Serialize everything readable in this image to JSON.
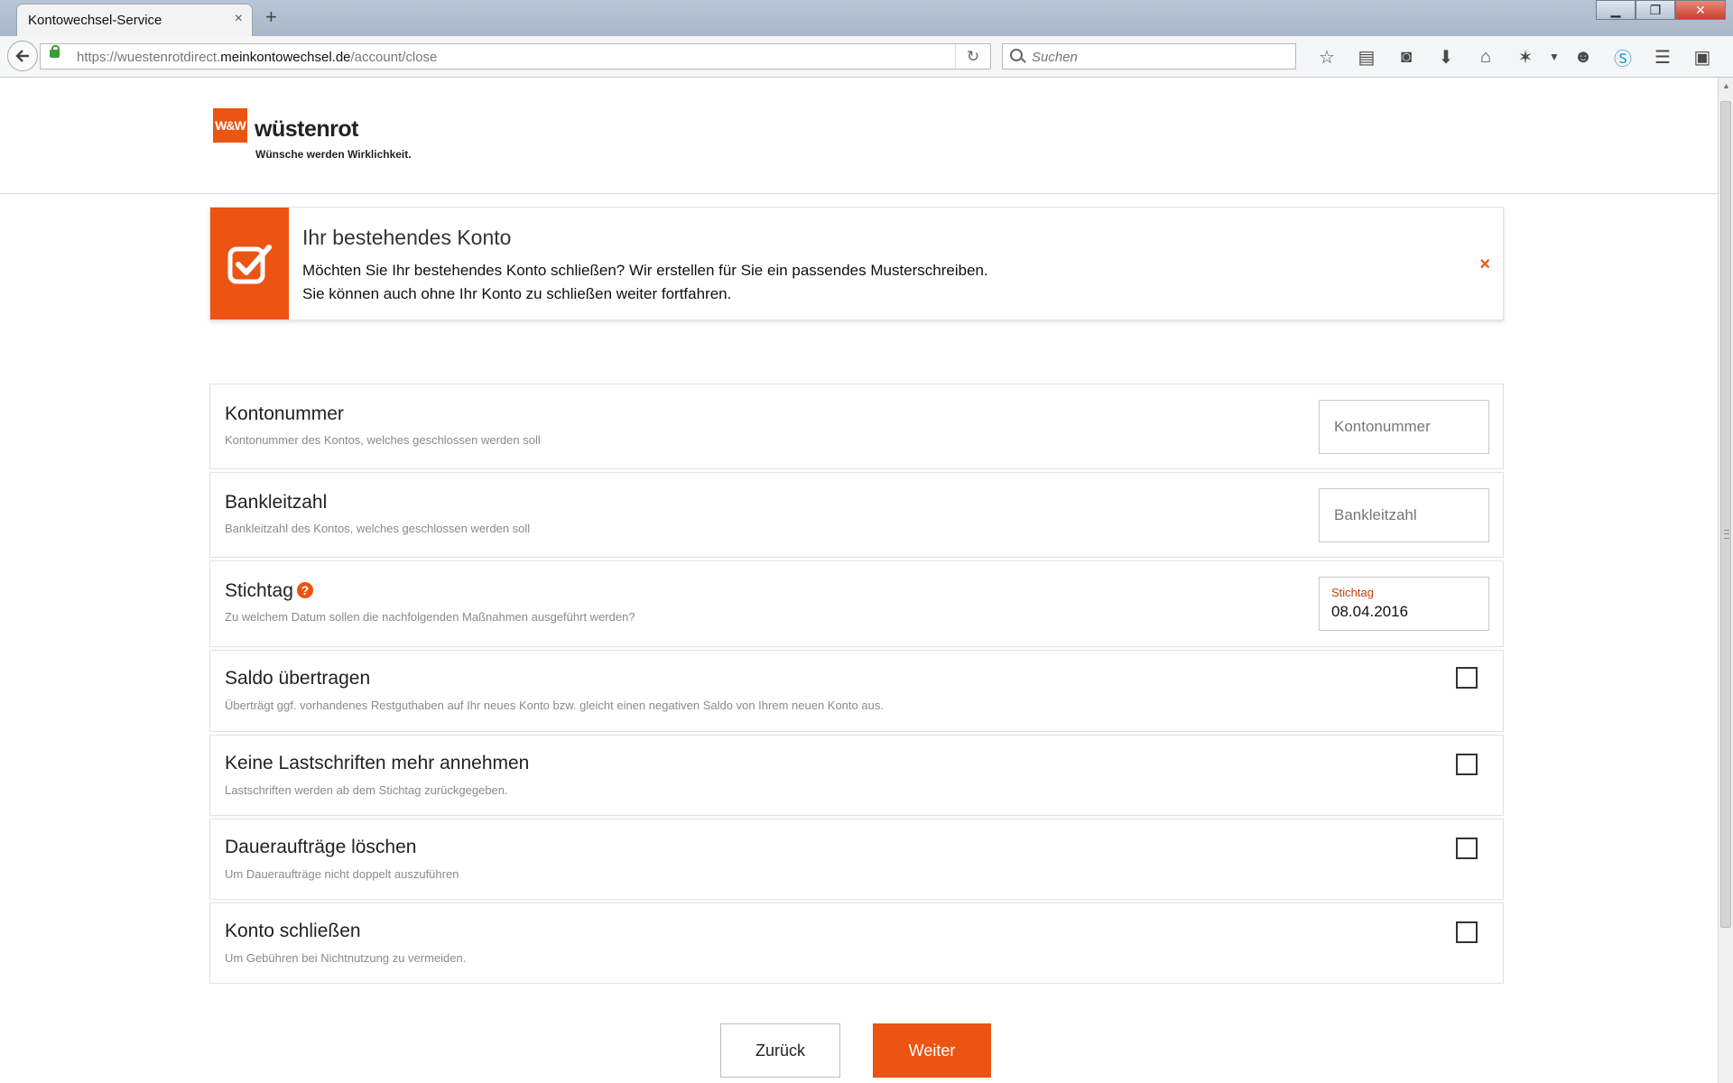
{
  "browser": {
    "tab_title": "Kontowechsel-Service",
    "tab_close": "×",
    "new_tab": "+",
    "url_prefix": "https://wuestenrotdirect.",
    "url_domain": "meinkontowechsel.de",
    "url_path": "/account/close",
    "search_placeholder": "Suchen",
    "window_controls": {
      "minimize": "▁",
      "maximize": "❐",
      "close": "✕"
    },
    "toolbar_icons": [
      "star-icon",
      "reading-list-icon",
      "pocket-icon",
      "download-icon",
      "home-icon",
      "extension-icon",
      "chevron-down-icon",
      "emoji-icon",
      "skype-icon",
      "menu-icon",
      "account-icon"
    ]
  },
  "brand": {
    "logo_mark": "W&W",
    "name": "wüstenrot",
    "claim": "Wünsche werden Wirklichkeit.",
    "accent_color": "#ec5413"
  },
  "notice": {
    "title": "Ihr bestehendes Konto",
    "line1": "Möchten Sie Ihr bestehendes Konto schließen? Wir erstellen für Sie ein passendes Musterschreiben.",
    "line2": "Sie können auch ohne Ihr Konto zu schließen weiter fortfahren.",
    "close": "×",
    "icon": "checkbox-checked-icon"
  },
  "form": {
    "kontonummer": {
      "title": "Kontonummer",
      "desc": "Kontonummer des Kontos, welches geschlossen werden soll",
      "placeholder": "Kontonummer",
      "value": ""
    },
    "bankleitzahl": {
      "title": "Bankleitzahl",
      "desc": "Bankleitzahl des Kontos, welches geschlossen werden soll",
      "placeholder": "Bankleitzahl",
      "value": ""
    },
    "stichtag": {
      "title": "Stichtag",
      "help": "?",
      "desc": "Zu welchem Datum sollen die nachfolgenden Maßnahmen ausgeführt werden?",
      "label": "Stichtag",
      "value": "08.04.2016"
    },
    "saldo": {
      "title": "Saldo übertragen",
      "desc": "Überträgt ggf. vorhandenes Restguthaben auf Ihr neues Konto bzw. gleicht einen negativen Saldo von Ihrem neuen Konto aus.",
      "checked": false
    },
    "lastschriften": {
      "title": "Keine Lastschriften mehr annehmen",
      "desc": "Lastschriften werden ab dem Stichtag zurückgegeben.",
      "checked": false
    },
    "dauerauftraege": {
      "title": "Daueraufträge löschen",
      "desc": "Um Daueraufträge nicht doppelt auszuführen",
      "checked": false
    },
    "konto_schliessen": {
      "title": "Konto schließen",
      "desc": "Um Gebühren bei Nichtnutzung zu vermeiden.",
      "checked": false
    }
  },
  "actions": {
    "back_label": "Zurück",
    "next_label": "Weiter"
  }
}
